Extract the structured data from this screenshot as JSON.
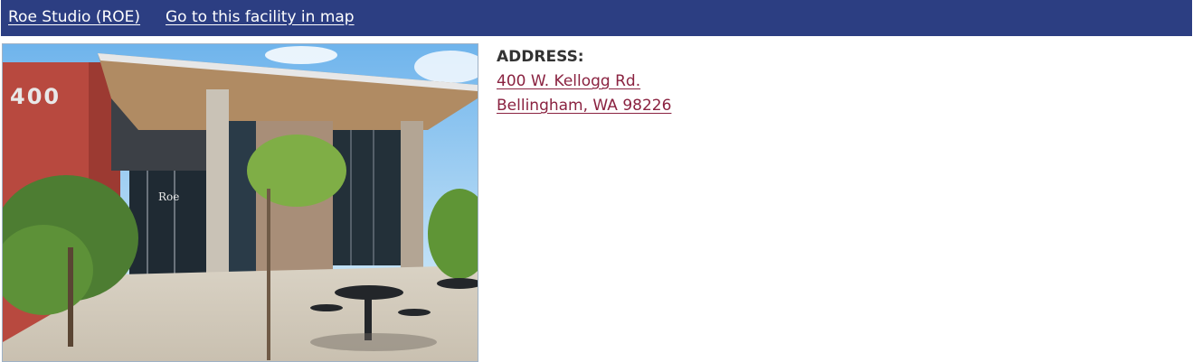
{
  "header": {
    "facility_name": "Roe Studio (ROE)",
    "map_link": "Go to this facility in map",
    "background_color": "#2c3e82"
  },
  "photo": {
    "building_number": "400",
    "entrance_sign": "Roe"
  },
  "address": {
    "label": "ADDRESS:",
    "line1": "400 W. Kellogg Rd.",
    "line2": "Bellingham, WA 98226",
    "link_color": "#8a2240"
  }
}
